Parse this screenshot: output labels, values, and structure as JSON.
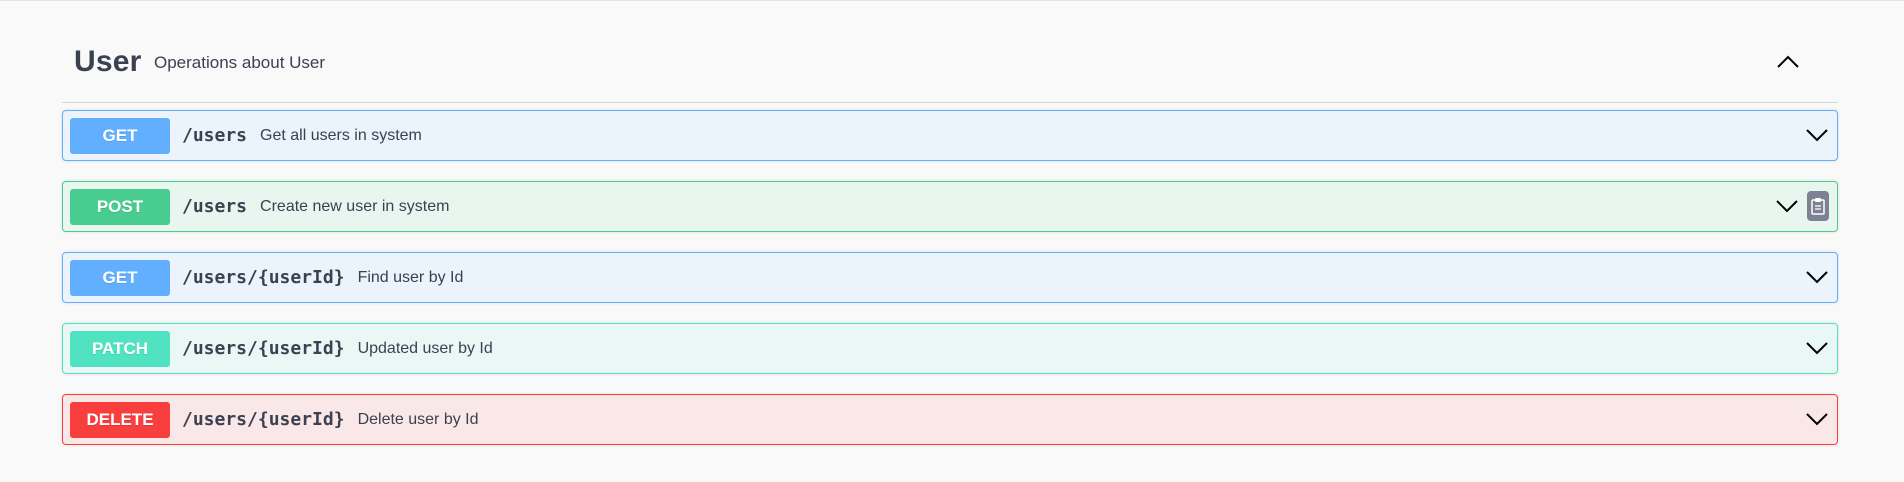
{
  "tag": {
    "name": "User",
    "description": "Operations about User",
    "collapse_icon": "chevron-up-icon"
  },
  "operations": [
    {
      "method": "GET",
      "path": "/users",
      "summary": "Get all users in system",
      "color": "#61affe"
    },
    {
      "method": "POST",
      "path": "/users",
      "summary": "Create new user in system",
      "color": "#49cc90",
      "copy_icon": "clipboard-icon"
    },
    {
      "method": "GET",
      "path": "/users/{userId}",
      "summary": "Find user by Id",
      "color": "#61affe"
    },
    {
      "method": "PATCH",
      "path": "/users/{userId}",
      "summary": "Updated user by Id",
      "color": "#50e3c2"
    },
    {
      "method": "DELETE",
      "path": "/users/{userId}",
      "summary": "Delete user by Id",
      "color": "#f93e3e"
    }
  ],
  "icons": {
    "expand": "chevron-down-icon",
    "collapse": "chevron-up-icon",
    "copy": "clipboard-icon"
  }
}
